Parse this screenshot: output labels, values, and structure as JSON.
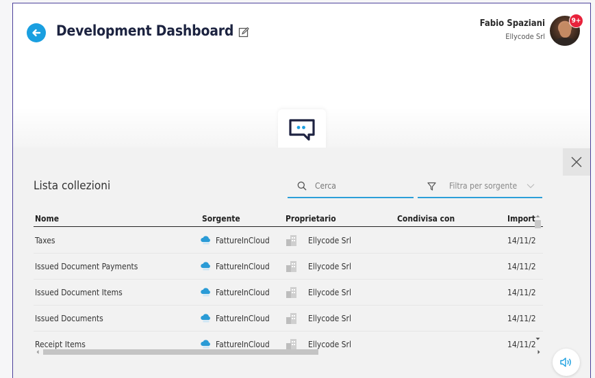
{
  "header": {
    "title": "Development Dashboard",
    "user_name": "Fabio Spaziani",
    "user_company": "Ellycode Srl",
    "badge": "9+"
  },
  "panel": {
    "title": "Lista collezioni",
    "search_placeholder": "Cerca",
    "filter_placeholder": "Filtra per sorgente"
  },
  "table": {
    "columns": [
      "Nome",
      "Sorgente",
      "Proprietario",
      "Condivisa con",
      "Import"
    ],
    "rows": [
      {
        "name": "Taxes",
        "source": "FattureInCloud",
        "owner": "Ellycode Srl",
        "shared": "",
        "import": "14/11/2"
      },
      {
        "name": "Issued Document Payments",
        "source": "FattureInCloud",
        "owner": "Ellycode Srl",
        "shared": "",
        "import": "14/11/2"
      },
      {
        "name": "Issued Document Items",
        "source": "FattureInCloud",
        "owner": "Ellycode Srl",
        "shared": "",
        "import": "14/11/2"
      },
      {
        "name": "Issued Documents",
        "source": "FattureInCloud",
        "owner": "Ellycode Srl",
        "shared": "",
        "import": "14/11/2"
      },
      {
        "name": "Receipt Items",
        "source": "FattureInCloud",
        "owner": "Ellycode Srl",
        "shared": "",
        "import": "14/11/2"
      }
    ]
  },
  "colors": {
    "accent": "#1a9fe0",
    "badge": "#e8223b",
    "frame": "#4b3f9a"
  },
  "icons": [
    "back-arrow-icon",
    "edit-icon",
    "chat-icon",
    "close-icon",
    "search-icon",
    "filter-icon",
    "chevron-down-icon",
    "cloud-source-icon",
    "building-icon",
    "sound-icon"
  ]
}
